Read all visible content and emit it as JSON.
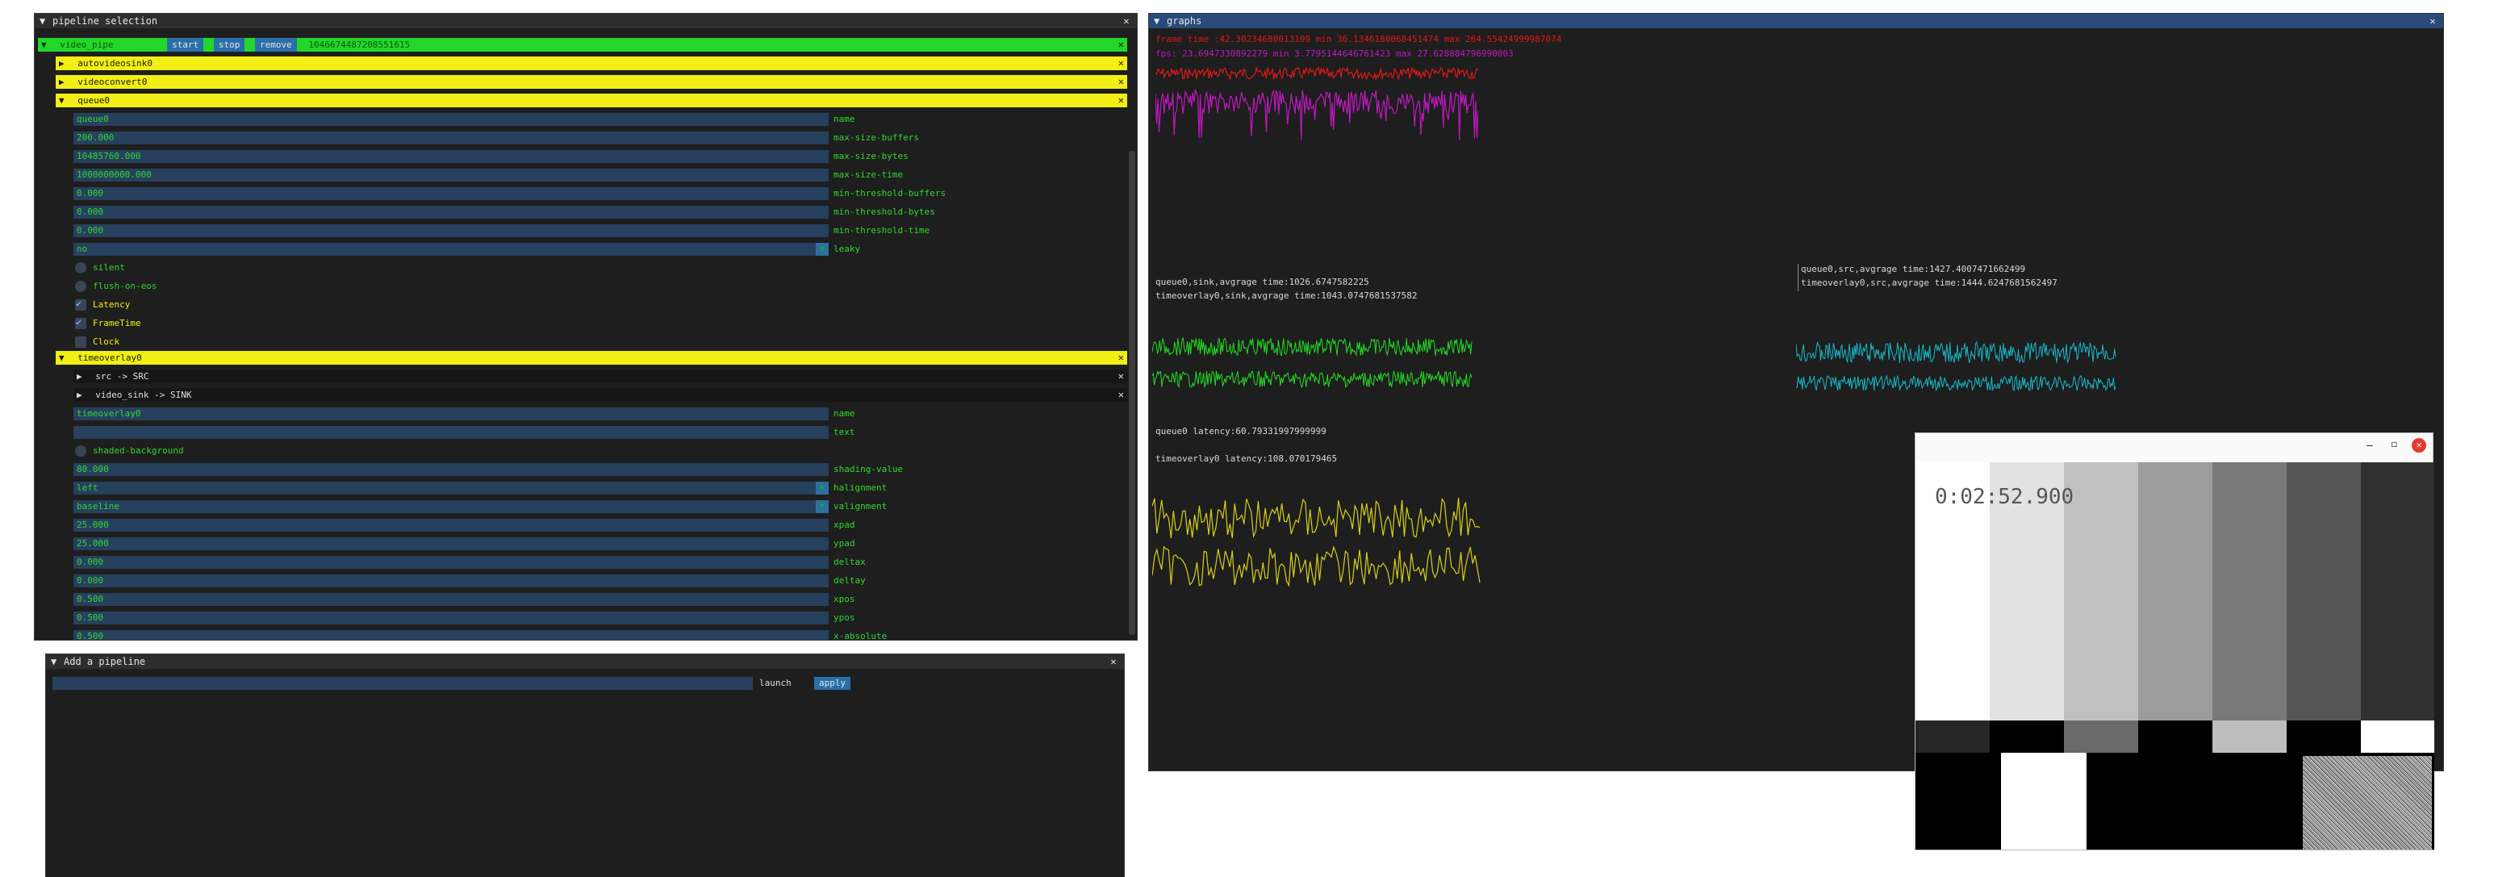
{
  "pipeline_window": {
    "title": "pipeline selection",
    "pipeline": {
      "name": "video_pipe",
      "start_label": "start",
      "stop_label": "stop",
      "remove_label": "remove",
      "time": "1046674487208551615"
    },
    "elements": {
      "autovideosink": "autovideosink0",
      "videoconvert": "videoconvert0",
      "queue": "queue0",
      "timeoverlay": "timeoverlay0"
    },
    "queue_props": [
      {
        "value": "queue0",
        "label": "name"
      },
      {
        "value": "200.000",
        "label": "max-size-buffers"
      },
      {
        "value": "10485760.000",
        "label": "max-size-bytes"
      },
      {
        "value": "1000000000.000",
        "label": "max-size-time"
      },
      {
        "value": "0.000",
        "label": "min-threshold-buffers"
      },
      {
        "value": "0.000",
        "label": "min-threshold-bytes"
      },
      {
        "value": "0.000",
        "label": "min-threshold-time"
      },
      {
        "value": "no",
        "label": "leaky"
      }
    ],
    "queue_checks": [
      {
        "label": "silent",
        "checked": false
      },
      {
        "label": "flush-on-eos",
        "checked": false
      },
      {
        "label": "Latency",
        "checked": true
      },
      {
        "label": "FrameTime",
        "checked": true
      },
      {
        "label": "Clock",
        "checked": false
      }
    ],
    "pads": {
      "src": "src -> SRC",
      "sink": "video_sink -> SINK"
    },
    "overlay_props": [
      {
        "value": "timeoverlay0",
        "label": "name"
      },
      {
        "value": "",
        "label": "text"
      }
    ],
    "overlay_check": "shaded-background",
    "overlay_props2": [
      {
        "value": "80.000",
        "label": "shading-value"
      },
      {
        "value": "left",
        "label": "halignment"
      },
      {
        "value": "baseline",
        "label": "valignment"
      },
      {
        "value": "25.000",
        "label": "xpad"
      },
      {
        "value": "25.000",
        "label": "ypad"
      },
      {
        "value": "0.000",
        "label": "deltax"
      },
      {
        "value": "0.000",
        "label": "deltay"
      },
      {
        "value": "0.500",
        "label": "xpos"
      },
      {
        "value": "0.500",
        "label": "ypos"
      },
      {
        "value": "0.500",
        "label": "x-absolute"
      }
    ]
  },
  "add_pipeline": {
    "title": "Add a pipeline",
    "input_value": "",
    "launch_label": "launch",
    "apply_label": "apply"
  },
  "graphs": {
    "title": "graphs",
    "frame_time_stat": "frame time :42.30234680013109 min 36.1346180068451474 max 264.55424999987074",
    "fps_stat": "fps: 23.6947330892279 min 3.7795144646761423 max 27.628884796990003",
    "queue_sink": "queue0,sink,avgrage time:1026.6747582225",
    "overlay_sink": "timeoverlay0,sink,avgrage time:1043.0747681537582",
    "queue_src": "queue0,src,avgrage time:1427.4007471662499",
    "overlay_src": "timeoverlay0,src,avgrage time:1444.6247681562497",
    "queue_latency": "queue0 latency:60.79331997999999",
    "overlay_latency": "timeoverlay0 latency:108.070179465",
    "colors": {
      "frame": "#e01818",
      "fps": "#c018c0",
      "green": "#22dd22",
      "cyan": "#18b8c8",
      "yellow": "#d8d018"
    }
  },
  "video_window": {
    "timestamp": "0:02:52.900",
    "minimize_icon": "minimize-icon",
    "maximize_icon": "maximize-icon",
    "close_icon": "close-icon"
  }
}
